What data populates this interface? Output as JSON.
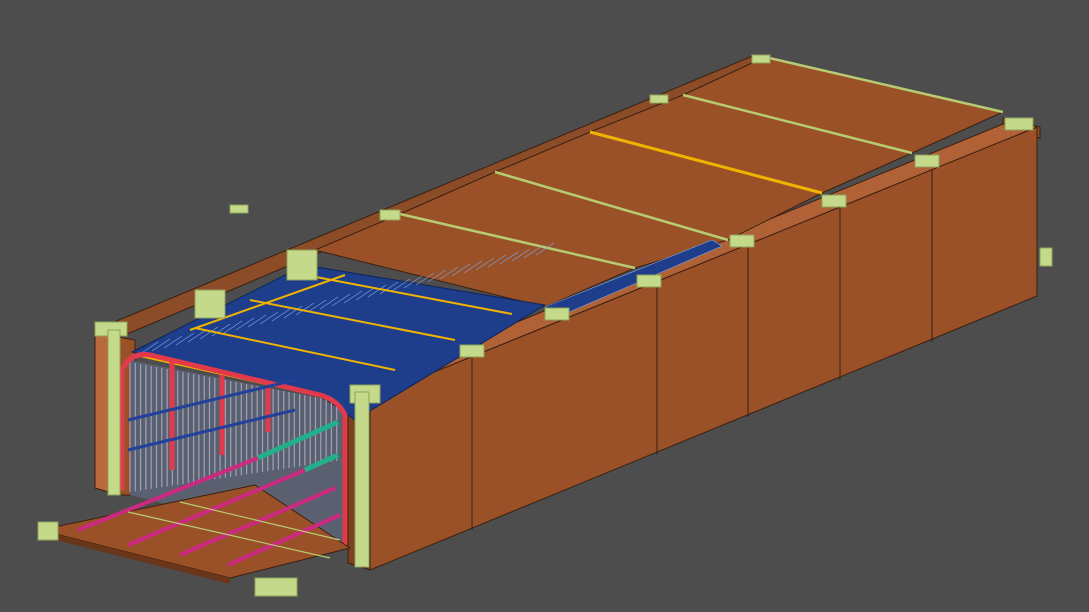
{
  "viewport": {
    "name": "3d-model-viewport",
    "background_color": "#4d4d4d"
  },
  "model": {
    "description_visible_text": "",
    "colors": {
      "wall_face": "#9a5128",
      "wall_top": "#8d4c28",
      "wall_inner": "#b86a3a",
      "wall_outline": "#3a1f10",
      "roof_panel": "#9a5128",
      "roof_seam": "#b7cc72",
      "post_cap": "#c5d98a",
      "post_cap_dark": "#8fa35a",
      "blue_insulation": "#1e3d8a",
      "blue_line": "#7aa2e0",
      "yellow_rib": "#f0b400",
      "red_frame": "#e23a4a",
      "gray_studs": "#9ea4b8",
      "magenta_pipe": "#cc2a80",
      "teal_pipe": "#22b08a",
      "floor": "#9a5128"
    }
  }
}
